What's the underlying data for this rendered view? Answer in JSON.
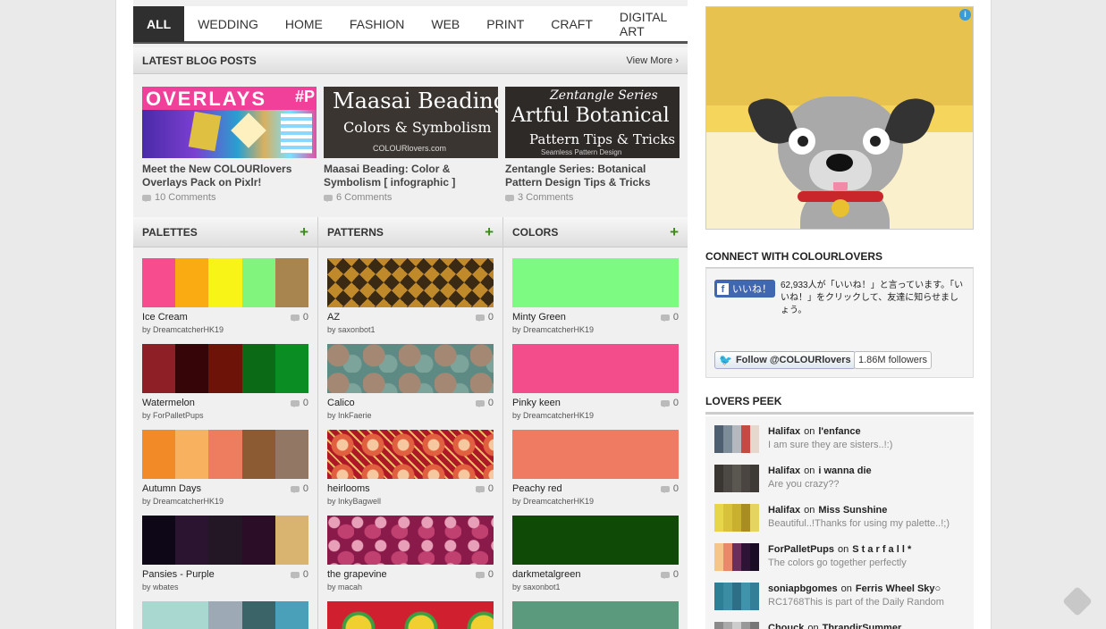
{
  "nav": {
    "tabs": [
      "ALL",
      "WEDDING",
      "HOME",
      "FASHION",
      "WEB",
      "PRINT",
      "CRAFT",
      "DIGITAL ART"
    ]
  },
  "blog": {
    "heading": "LATEST BLOG POSTS",
    "view_more": "View More ›",
    "posts": [
      {
        "thumb_text": "OVERLAYS",
        "thumb_tag": "#P",
        "title": "Meet the New COLOURlovers Overlays Pack on Pixlr!",
        "comments": "10 Comments"
      },
      {
        "thumb_text": "Maasai Beading",
        "thumb_sub": "Colors & Symbolism",
        "thumb_foot": "COLOURlovers.com",
        "title": "Maasai Beading: Color & Symbolism [ infographic ]",
        "comments": "6 Comments"
      },
      {
        "thumb_text": "Zentangle Series",
        "thumb_sub": "Artful Botanical",
        "thumb_foot": "Pattern Tips & Tricks",
        "thumb_foot2": "Seamless Pattern Design",
        "title": "Zentangle Series: Botanical Pattern Design Tips & Tricks",
        "comments": "3 Comments"
      }
    ]
  },
  "palettes": {
    "heading": "PALETTES",
    "add": "+",
    "items": [
      {
        "name": "Ice Cream",
        "by": "by DreamcatcherHK19",
        "count": "0",
        "colors": [
          "#f74c8d",
          "#fbab12",
          "#f8f418",
          "#80f47d",
          "#a8844e"
        ]
      },
      {
        "name": "Watermelon",
        "by": "by ForPalletPups",
        "count": "0",
        "colors": [
          "#8e1f26",
          "#360508",
          "#6e1308",
          "#0b6a16",
          "#0a8e23"
        ]
      },
      {
        "name": "Autumn Days",
        "by": "by DreamcatcherHK19",
        "count": "0",
        "colors": [
          "#f28a27",
          "#f8b25f",
          "#ee7c5e",
          "#8c5a33",
          "#927764"
        ]
      },
      {
        "name": "Pansies - Purple",
        "by": "by wbates",
        "count": "0",
        "colors": [
          "#0d0718",
          "#2a1430",
          "#231625",
          "#2b0d28",
          "#d8b470"
        ]
      },
      {
        "name": "",
        "by": "",
        "count": "",
        "colors": [
          "#a9d8d0",
          "#a9d8d0",
          "#9daab5",
          "#3a6468",
          "#4aa0b8"
        ]
      }
    ]
  },
  "patterns": {
    "heading": "PATTERNS",
    "add": "+",
    "items": [
      {
        "name": "AZ",
        "by": "by saxonbot1",
        "count": "0"
      },
      {
        "name": "Calico",
        "by": "by InkFaerie",
        "count": "0"
      },
      {
        "name": "heirlooms",
        "by": "by InkyBagwell",
        "count": "0"
      },
      {
        "name": "the grapevine",
        "by": "by macah",
        "count": "0"
      },
      {
        "name": "",
        "by": "",
        "count": ""
      }
    ]
  },
  "colors": {
    "heading": "COLORS",
    "add": "+",
    "items": [
      {
        "name": "Minty Green",
        "by": "by DreamcatcherHK19",
        "count": "0",
        "hex": "#7dfa82"
      },
      {
        "name": "Pinky keen",
        "by": "by DreamcatcherHK19",
        "count": "0",
        "hex": "#f44d8b"
      },
      {
        "name": "Peachy red",
        "by": "by DreamcatcherHK19",
        "count": "0",
        "hex": "#ef7b62"
      },
      {
        "name": "darkmetalgreen",
        "by": "by saxonbot1",
        "count": "0",
        "hex": "#0f4a06"
      },
      {
        "name": "",
        "by": "",
        "count": "",
        "hex": "#5c9a7e"
      }
    ]
  },
  "sidebar": {
    "connect_heading": "CONNECT WITH COLOURLOVERS",
    "like_button": "いいね！",
    "like_text": "62,933人が「いいね！」と言っています。「いいね！」をクリックして、友達に知らせましょう。",
    "follow_button": "Follow @COLOURlovers",
    "followers": "1.86M followers",
    "peek_heading": "LOVERS PEEK",
    "peek": [
      {
        "user": "Halifax",
        "on": "on",
        "target": "l'enfance",
        "comment": "I am sure they are sisters..!:)",
        "colors": [
          "#4f5f72",
          "#7c8c99",
          "#b4b9bf",
          "#c44a43",
          "#e6d8cc"
        ]
      },
      {
        "user": "Halifax",
        "on": "on",
        "target": "i wanna die",
        "comment": "Are you crazy??",
        "colors": [
          "#3a3733",
          "#4c4843",
          "#5a5650",
          "#4a4540",
          "#3e3a36"
        ]
      },
      {
        "user": "Halifax",
        "on": "on",
        "target": "Miss Sunshine",
        "comment": "Beautiful..!Thanks for using my palette..!;)",
        "colors": [
          "#e8d64a",
          "#d8c23c",
          "#c9b02e",
          "#a88e22",
          "#e5d560"
        ]
      },
      {
        "user": "ForPalletPups",
        "on": "on",
        "target": "S t a r f a l l *",
        "comment": "The colors go together perfectly",
        "colors": [
          "#f5c58a",
          "#e88a6a",
          "#6a2f5a",
          "#2d1436",
          "#1a0c24"
        ]
      },
      {
        "user": "soniapbgomes",
        "on": "on",
        "target": "Ferris Wheel Sky○",
        "comment": "RC1768This is part of the Daily Random",
        "colors": [
          "#2c7f95",
          "#3a8da2",
          "#2c6f86",
          "#3f93aa",
          "#347f98"
        ]
      },
      {
        "user": "Chouck",
        "on": "on",
        "target": "ThrandirSummer",
        "comment": "",
        "colors": [
          "#8a8a8a",
          "#aaa",
          "#ccc",
          "#999",
          "#777"
        ]
      }
    ]
  }
}
